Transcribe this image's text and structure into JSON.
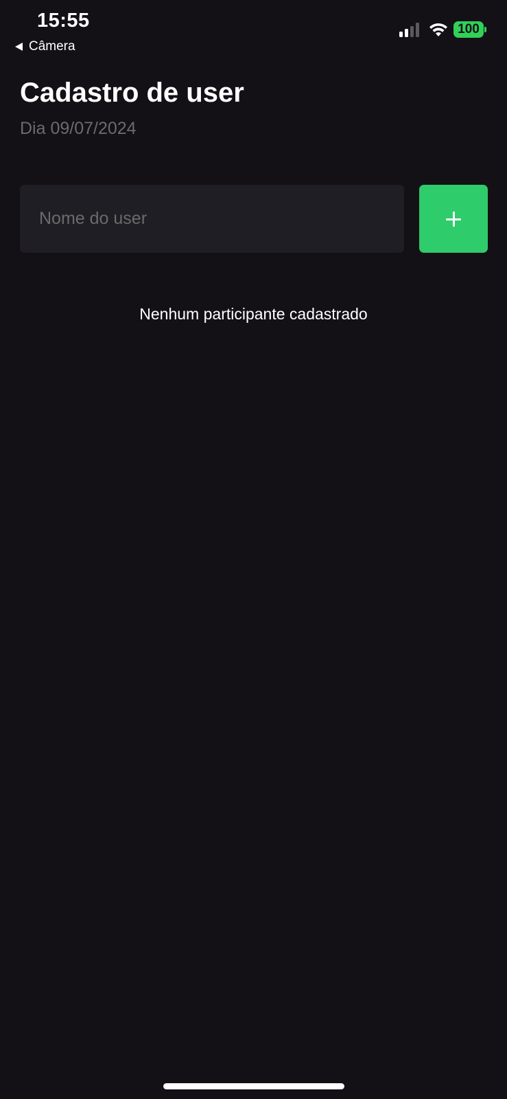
{
  "status_bar": {
    "time": "15:55",
    "back_label": "Câmera",
    "battery_level": "100",
    "signal_bars_active": 2,
    "signal_bars_total": 4,
    "wifi_icon": "wifi-icon",
    "colors": {
      "battery": "#30d158",
      "signal_active": "#ffffff",
      "signal_inactive": "#5a5a5e"
    }
  },
  "header": {
    "title": "Cadastro de user",
    "subtitle": "Dia 09/07/2024"
  },
  "form": {
    "name_input": {
      "placeholder": "Nome do user",
      "value": ""
    },
    "add_button": {
      "icon": "plus-icon",
      "color": "#2ecc6a"
    }
  },
  "list": {
    "empty_message": "Nenhum participante cadastrado"
  },
  "colors": {
    "background": "#131016",
    "input_background": "#1f1e25",
    "muted_text": "#6b6b6b"
  }
}
